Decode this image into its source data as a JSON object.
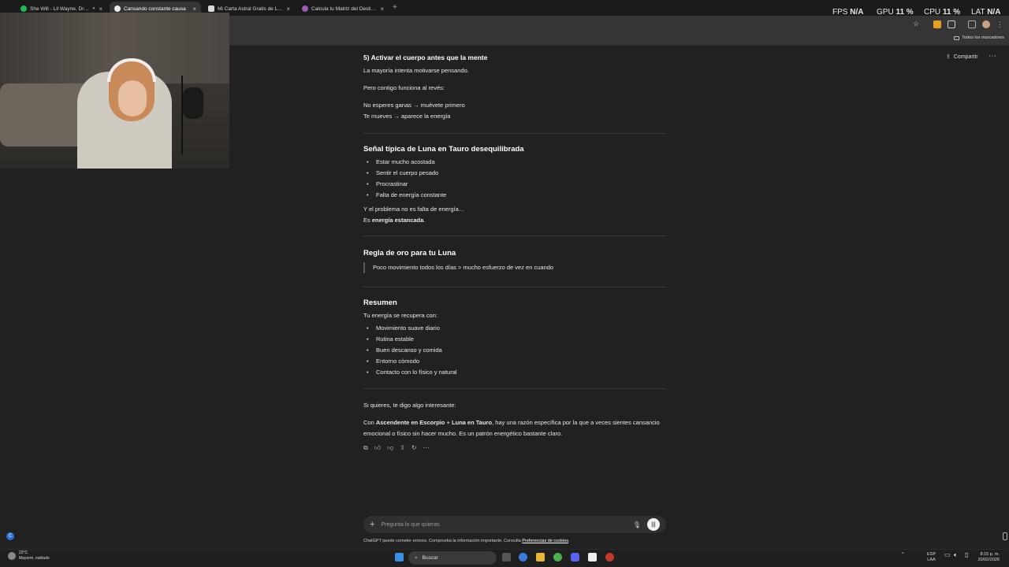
{
  "browser": {
    "tabs": [
      {
        "title": "She Will - Lil Wayne, Drake",
        "active": false,
        "favicon": "spotify-icon",
        "color": "#1db954"
      },
      {
        "title": "Cansando constante causa",
        "active": true,
        "favicon": "chatgpt-icon",
        "color": "#ececec"
      },
      {
        "title": "Mi Carta Astral Gratis de Los A",
        "active": false,
        "favicon": "site-icon",
        "color": "#d9d9d9"
      },
      {
        "title": "Calcula tu Matriz del Destino -",
        "active": false,
        "favicon": "site-icon",
        "color": "#9b59b6"
      }
    ],
    "bookmarks_folder": "Todos los marcadores"
  },
  "perf_overlay": {
    "fps_label": "FPS",
    "fps_value": "N/A",
    "gpu_label": "GPU",
    "gpu_value": "11 %",
    "cpu_label": "CPU",
    "cpu_value": "11 %",
    "lat_label": "LAT",
    "lat_value": "N/A"
  },
  "header": {
    "share_label": "Compartir"
  },
  "content": {
    "s5_title": "5) Activar el cuerpo antes que la mente",
    "s5_p1": "La mayoría intenta motivarse pensando.",
    "s5_p2": "Pero contigo funciona al revés:",
    "s5_p3a": "No esperes ganas → muévete primero",
    "s5_p3b": "Te mueves → aparece la energía",
    "signal_title": "Señal típica de Luna en Tauro desequilibrada",
    "signal_items": [
      "Estar mucho acostada",
      "Sentir el cuerpo pesado",
      "Procrastinar",
      "Falta de energía constante"
    ],
    "signal_p1": "Y el problema no es falta de energía…",
    "signal_p2_pre": "Es ",
    "signal_p2_bold": "energía estancada",
    "signal_p2_post": ".",
    "rule_title": "Regla de oro para tu Luna",
    "rule_quote": "Poco movimiento todos los días > mucho esfuerzo de vez en cuando",
    "summary_title": "Resumen",
    "summary_intro": "Tu energía se recupera con:",
    "summary_items": [
      "Movimiento suave diario",
      "Rutina estable",
      "Buen descanso y comida",
      "Entorno cómodo",
      "Contacto con lo físico y natural"
    ],
    "closing_p1": "Si quieres, te digo algo interesante:",
    "closing_pre": "Con ",
    "closing_bold1": "Ascendente en Escorpio",
    "closing_mid": " + ",
    "closing_bold2": "Luna en Tauro",
    "closing_post": ", hay una razón específica por la que a veces sientes cansancio emocional o físico sin hacer mucho. Es un patrón energético bastante claro."
  },
  "composer": {
    "placeholder": "Pregunta lo que quieras"
  },
  "footer": {
    "disclaimer": "ChatGPT puede cometer errores. Comprueba la información importante. Consulta ",
    "cookies_link": "Preferencias de cookies",
    "disclaimer_end": "."
  },
  "taskbar": {
    "search_label": "Buscar",
    "weather_temp": "23°C",
    "weather_desc": "Mayorm. nublado",
    "lang_top": "ESP",
    "lang_bottom": "LAA",
    "time": "8:15 p. m.",
    "date": "20/02/2026"
  }
}
